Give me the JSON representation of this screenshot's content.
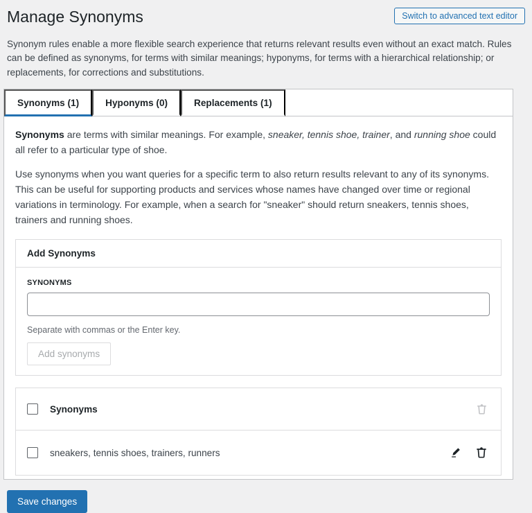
{
  "page": {
    "title": "Manage Synonyms",
    "advanced_editor_button": "Switch to advanced text editor",
    "description": "Synonym rules enable a more flexible search experience that returns relevant results even without an exact match. Rules can be defined as synonyms, for terms with similar meanings; hyponyms, for terms with a hierarchical relationship; or replacements, for corrections and substitutions."
  },
  "tabs": [
    {
      "label": "Synonyms (1)",
      "active": true
    },
    {
      "label": "Hyponyms (0)",
      "active": false
    },
    {
      "label": "Replacements (1)",
      "active": false
    }
  ],
  "synonyms_tab": {
    "intro": {
      "bold": "Synonyms",
      "text_1": " are terms with similar meanings. For example, ",
      "italic_1": "sneaker, tennis shoe, trainer",
      "text_2": ", and ",
      "italic_2": "running shoe",
      "text_3": " could all refer to a particular type of shoe."
    },
    "usage": "Use synonyms when you want queries for a specific term to also return results relevant to any of its synonyms. This can be useful for supporting products and services whose names have changed over time or regional variations in terminology. For example, when a search for \"sneaker\" should return sneakers, tennis shoes, trainers and running shoes.",
    "add_panel": {
      "title": "Add Synonyms",
      "field_label": "SYNONYMS",
      "input_value": "",
      "help_text": "Separate with commas or the Enter key.",
      "add_button": "Add synonyms"
    },
    "table": {
      "header": "Synonyms",
      "rows": [
        {
          "value": "sneakers, tennis shoes, trainers, runners"
        }
      ]
    }
  },
  "footer": {
    "save_button": "Save changes"
  },
  "colors": {
    "accent_blue": "#2271b1",
    "page_background": "#f0f0f1"
  }
}
